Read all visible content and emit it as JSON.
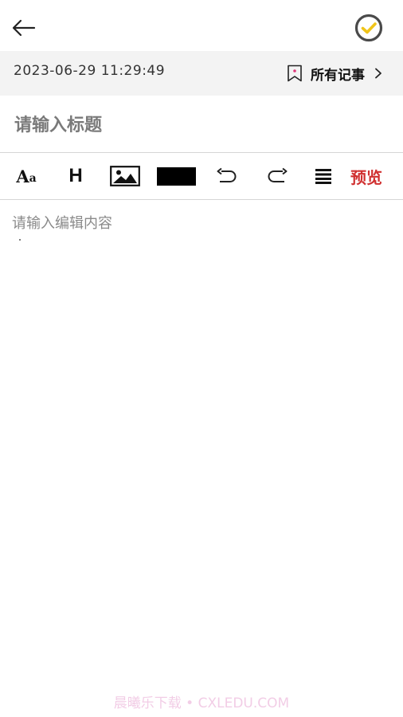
{
  "header": {
    "back_icon": "arrow-left-icon",
    "clock_icon": "clock-check-icon",
    "accent_color": "#f0c419"
  },
  "info": {
    "datetime": "2023-06-29 11:29:49",
    "category_label": "所有记事",
    "category_icon": "bookmark-icon"
  },
  "editor": {
    "title_placeholder": "请输入标题",
    "title_value": "",
    "content_placeholder": "请输入编辑内容",
    "content_value": ""
  },
  "toolbar": {
    "font_size_label_big": "A",
    "font_size_label_small": "a",
    "heading_label": "H",
    "image_icon": "image-icon",
    "text_color": "#000000",
    "undo_icon": "undo-icon",
    "redo_icon": "redo-icon",
    "list_icon": "align-icon",
    "preview_label": "预览",
    "preview_color": "#d03030"
  },
  "watermark": "晨曦乐下载 • CXLEDU.COM"
}
